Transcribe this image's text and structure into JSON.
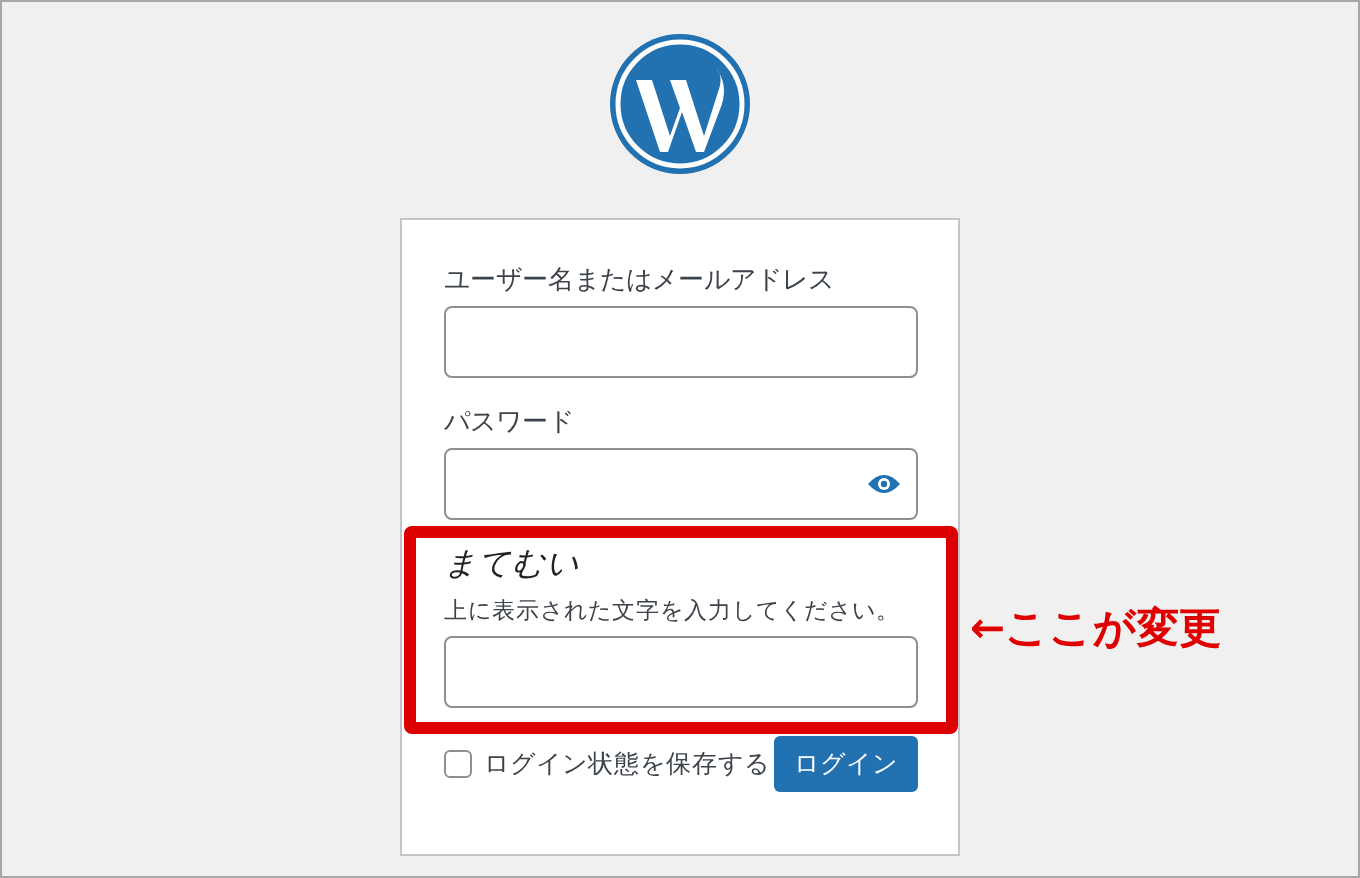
{
  "login_form": {
    "username_label": "ユーザー名またはメールアドレス",
    "password_label": "パスワード",
    "captcha_text": "まてむい",
    "captcha_hint": "上に表示された文字を入力してください。",
    "remember": {
      "label": "ログイン状態を保存する",
      "checked": false
    },
    "login_button": "ログイン"
  },
  "annotation": {
    "text": "←ここが変更"
  }
}
